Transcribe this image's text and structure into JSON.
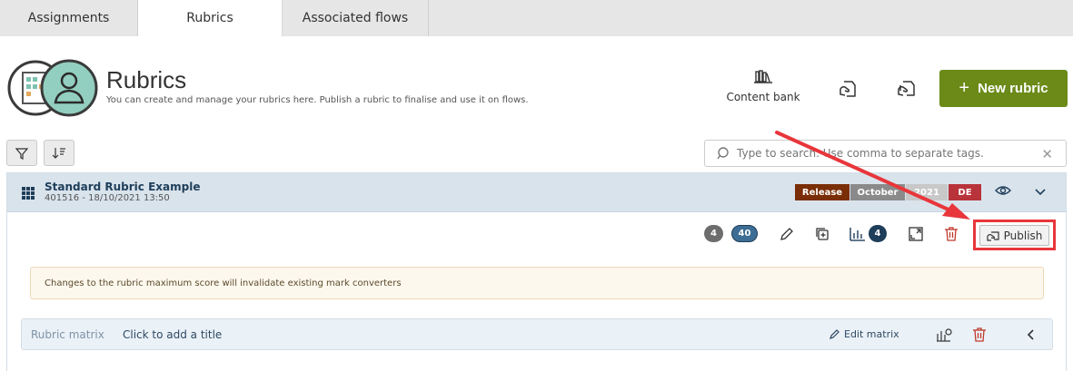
{
  "tabs": [
    {
      "label": "Assignments"
    },
    {
      "label": "Rubrics"
    },
    {
      "label": "Associated flows"
    }
  ],
  "header": {
    "title": "Rubrics",
    "subtitle": "You can create and manage your rubrics here. Publish a rubric to finalise and use it on flows.",
    "content_bank_label": "Content bank",
    "new_rubric_label": "New rubric"
  },
  "search": {
    "placeholder": "Type to search. Use comma to separate tags."
  },
  "rubric": {
    "title": "Standard Rubric Example",
    "meta": "401516 - 18/10/2021 13:50",
    "tags": [
      {
        "label": "Release",
        "color": "#7a2e07"
      },
      {
        "label": "October",
        "color": "#8a8a8a"
      },
      {
        "label": "2021",
        "color": "#c8c8c8"
      },
      {
        "label": "DE",
        "color": "#b8333a"
      }
    ],
    "pill_gray": "4",
    "pill_blue": "40",
    "chart_count": "4",
    "publish_label": "Publish",
    "warning": "Changes to the rubric maximum score will invalidate existing mark converters"
  },
  "matrix": {
    "label": "Rubric matrix",
    "title": "Click to add a title",
    "edit_label": "Edit matrix"
  },
  "colors": {
    "accent_green": "#6b8a18",
    "highlight_red": "#e8363b",
    "navy": "#1e3e5a"
  }
}
